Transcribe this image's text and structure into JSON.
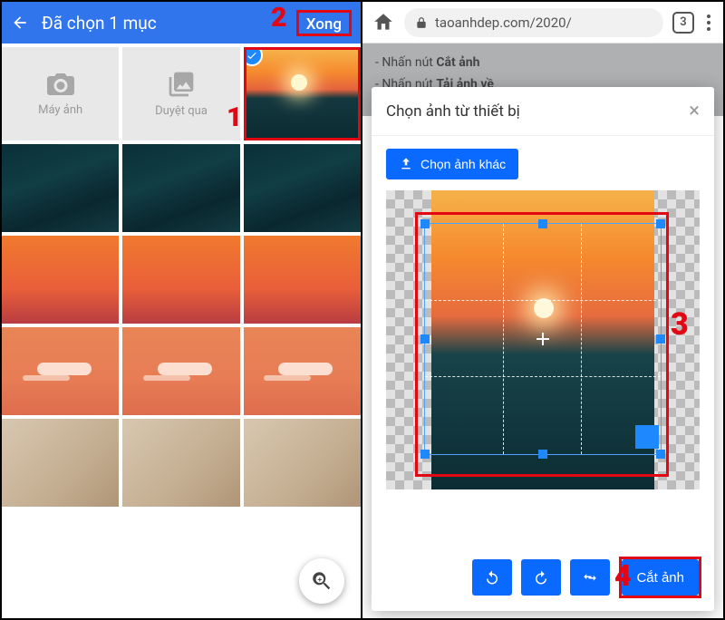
{
  "left": {
    "header": {
      "title": "Đã chọn 1 mục",
      "done": "Xong"
    },
    "tools": {
      "camera": "Máy ảnh",
      "browse": "Duyệt qua"
    },
    "annot": {
      "a1": "1",
      "a2": "2"
    }
  },
  "right": {
    "url": "taoanhdep.com/2020/",
    "tabcount": "3",
    "bg": {
      "line1": "- Nhấn nút ",
      "bold1": "Cắt ảnh",
      "line2": "- Nhấn nút ",
      "bold2": "Tải ảnh về"
    },
    "modal": {
      "title": "Chọn ảnh từ thiết bị",
      "choose_other": "Chọn ảnh khác",
      "crop": "Cắt ảnh"
    },
    "annot": {
      "a3": "3",
      "a4": "4"
    }
  }
}
